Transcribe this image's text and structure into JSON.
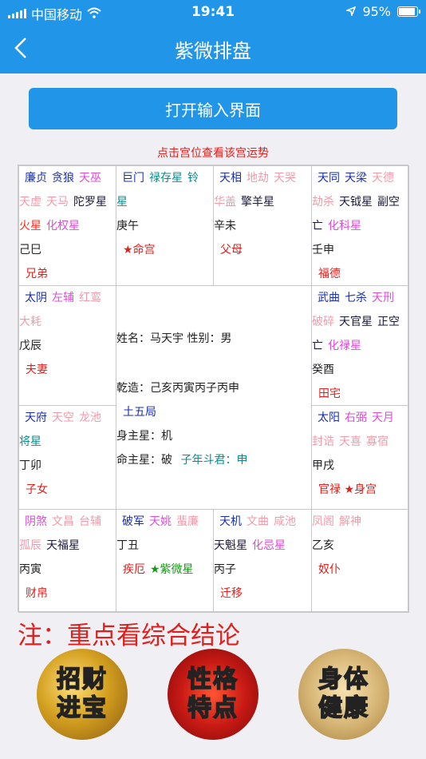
{
  "status": {
    "carrier": "中国移动",
    "time": "19:41",
    "battery": "95%",
    "battery_level": 0.95
  },
  "nav": {
    "title": "紫微排盘",
    "back_icon": "chevron-left-icon"
  },
  "open_button": "打开输入界面",
  "hint": "点击宫位查看该宫运势",
  "palaces": {
    "p1": {
      "lines": [
        [
          [
            "廉贞",
            "main"
          ],
          [
            "贪狼",
            "main"
          ],
          [
            "天巫",
            "pink"
          ]
        ],
        [
          [
            "天虚",
            "light"
          ],
          [
            "天马",
            "light"
          ],
          [
            "陀罗星",
            "dark"
          ]
        ],
        [
          [
            "火星",
            "major"
          ],
          [
            "化权星",
            "pink"
          ]
        ]
      ],
      "ganzhi": "己巳",
      "name": "兄弟"
    },
    "p2": {
      "lines": [
        [
          [
            "巨门",
            "main"
          ],
          [
            "禄存星",
            "teal"
          ],
          [
            "铃",
            "teal"
          ]
        ],
        [
          [
            "星",
            "teal"
          ]
        ]
      ],
      "ganzhi": "庚午",
      "name": "★命宫"
    },
    "p3": {
      "lines": [
        [
          [
            "天相",
            "main"
          ],
          [
            "地劫",
            "light"
          ],
          [
            "天哭",
            "light"
          ]
        ],
        [
          [
            "华盖",
            "light"
          ],
          [
            "擎羊星",
            "dark"
          ]
        ]
      ],
      "ganzhi": "辛未",
      "name": "父母"
    },
    "p4": {
      "lines": [
        [
          [
            "天同",
            "main"
          ],
          [
            "天梁",
            "main"
          ],
          [
            "天德",
            "light"
          ]
        ],
        [
          [
            "劫杀",
            "light"
          ],
          [
            "天钺星",
            "dark"
          ],
          [
            "副空",
            "dark"
          ]
        ],
        [
          [
            "亡",
            "dark"
          ],
          [
            "化科星",
            "pink"
          ]
        ]
      ],
      "ganzhi": "壬申",
      "name": "福德"
    },
    "p5": {
      "lines": [
        [
          [
            "太阴",
            "main"
          ],
          [
            "左辅",
            "pink"
          ],
          [
            "红鸾",
            "light"
          ]
        ],
        [
          [
            "大耗",
            "light"
          ]
        ]
      ],
      "ganzhi": "戊辰",
      "name": "夫妻"
    },
    "p6": {
      "lines": [
        [
          [
            "武曲",
            "main"
          ],
          [
            "七杀",
            "main"
          ],
          [
            "天刑",
            "pink"
          ]
        ],
        [
          [
            "破碎",
            "light"
          ],
          [
            "天官星",
            "dark"
          ],
          [
            "正空",
            "dark"
          ]
        ],
        [
          [
            "亡",
            "dark"
          ],
          [
            "化禄星",
            "pink"
          ]
        ]
      ],
      "ganzhi": "癸酉",
      "name": "田宅"
    },
    "p7": {
      "lines": [
        [
          [
            "天府",
            "main"
          ],
          [
            "天空",
            "light"
          ],
          [
            "龙池",
            "light"
          ]
        ],
        [
          [
            "将星",
            "teal"
          ]
        ]
      ],
      "ganzhi": "丁卯",
      "name": "子女"
    },
    "p8": {
      "lines": [
        [
          [
            "太阳",
            "main"
          ],
          [
            "右弼",
            "pink"
          ],
          [
            "天月",
            "pink"
          ]
        ],
        [
          [
            "封诰",
            "light"
          ],
          [
            "天喜",
            "light"
          ],
          [
            "寡宿",
            "light"
          ]
        ]
      ],
      "ganzhi": "甲戌",
      "name": "官禄 ★身宫"
    },
    "p9": {
      "lines": [
        [
          [
            "阴煞",
            "pink"
          ],
          [
            "文昌",
            "light"
          ],
          [
            "台辅",
            "light"
          ]
        ],
        [
          [
            "孤辰",
            "light"
          ],
          [
            "天福星",
            "dark"
          ]
        ]
      ],
      "ganzhi": "丙寅",
      "name": "财帛"
    },
    "p10": {
      "lines": [
        [
          [
            "破军",
            "main"
          ],
          [
            "天姚",
            "pink"
          ],
          [
            "蜚廉",
            "light"
          ]
        ]
      ],
      "ganzhi": "丁丑",
      "name": "疾厄",
      "extra": "★紫微星"
    },
    "p11": {
      "lines": [
        [
          [
            "天机",
            "main"
          ],
          [
            "文曲",
            "light"
          ],
          [
            "咸池",
            "light"
          ]
        ],
        [
          [
            "天魁星",
            "dark"
          ],
          [
            "化忌星",
            "pink"
          ]
        ]
      ],
      "ganzhi": "丙子",
      "name": "迁移"
    },
    "p12": {
      "lines": [
        [
          [
            "凤阁",
            "light"
          ],
          [
            "解神",
            "light"
          ]
        ]
      ],
      "ganzhi": "乙亥",
      "name": "奴仆"
    }
  },
  "center": {
    "line1": "姓名：马天宇   性别：男",
    "line2": "乾造：己亥丙寅丙子丙申",
    "line3": "土五局",
    "line4": "身主星：机",
    "line5_label": "命主星：破",
    "line5_extra": "子年斗君：申"
  },
  "note": "注：重点看综合结论",
  "circles": {
    "c1": [
      "招财",
      "进宝"
    ],
    "c2": [
      "性格",
      "特点"
    ],
    "c3": [
      "身体",
      "健康"
    ]
  },
  "colors": {
    "primary": "#2196e8",
    "accent_red": "#e0201c"
  }
}
